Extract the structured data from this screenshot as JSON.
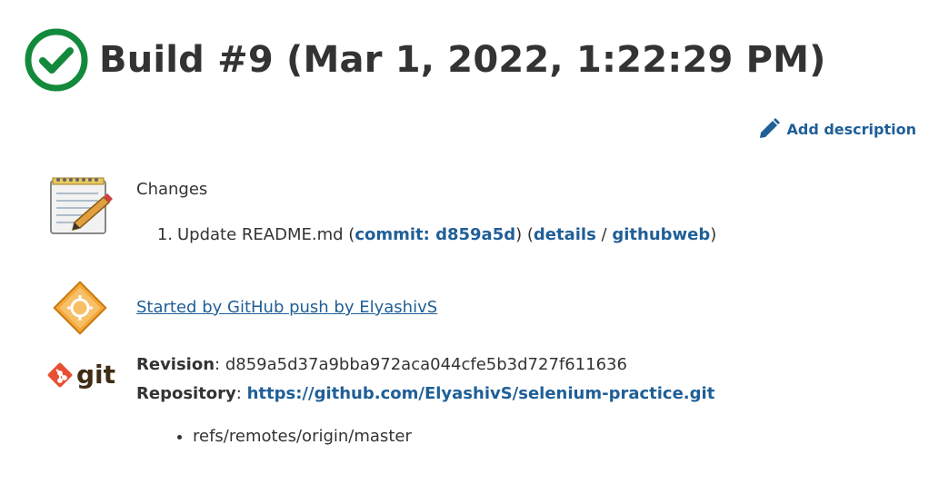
{
  "build": {
    "title": "Build #9 (Mar 1, 2022, 1:22:29 PM)",
    "status": "success",
    "status_color": "#138a3b"
  },
  "actions": {
    "add_description": "Add description",
    "link_color": "#1f5f97"
  },
  "changes": {
    "heading": "Changes",
    "items": [
      {
        "number": "1.",
        "message": "Update README.md",
        "commit_label": "commit: d859a5d",
        "details_label": "details",
        "separator": "/",
        "web_label": "githubweb"
      }
    ]
  },
  "cause": {
    "text": "Started by GitHub push by ElyashivS"
  },
  "git": {
    "logo_text": "git",
    "revision_label": "Revision",
    "revision": "d859a5d37a9bba972aca044cfe5b3d727f611636",
    "repository_label": "Repository",
    "repository_url": "https://github.com/ElyashivS/selenium-practice.git",
    "branches": [
      "refs/remotes/origin/master"
    ]
  }
}
